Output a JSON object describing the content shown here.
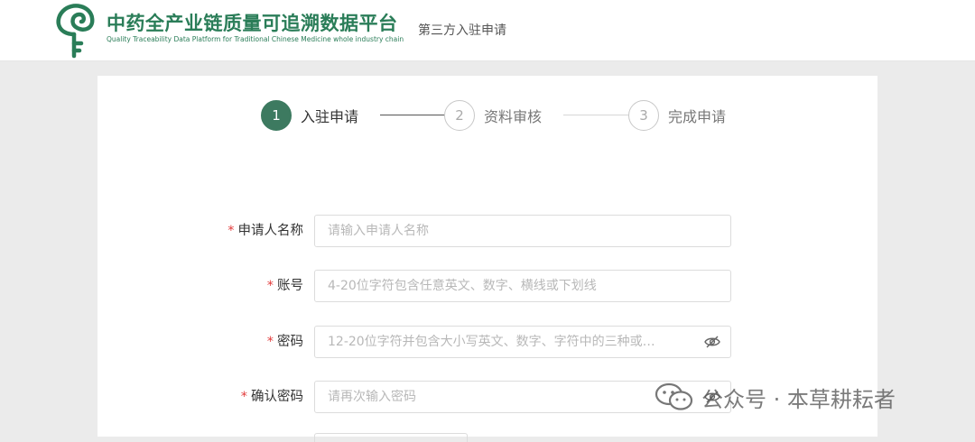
{
  "header": {
    "brand_title": "中药全产业链质量可追溯数据平台",
    "brand_subtitle": "Quality Traceability Data Platform for Traditional Chinese Medicine whole industry chain",
    "tag": "第三方入驻申请"
  },
  "steps": [
    {
      "number": "1",
      "label": "入驻申请",
      "state": "active"
    },
    {
      "number": "2",
      "label": "资料审核",
      "state": "pending"
    },
    {
      "number": "3",
      "label": "完成申请",
      "state": "pending"
    }
  ],
  "form": {
    "required_mark": "*",
    "fields": [
      {
        "label": "申请人名称",
        "value": "",
        "placeholder": "请输入申请人名称"
      },
      {
        "label": "账号",
        "value": "",
        "placeholder": "4-20位字符包含任意英文、数字、横线或下划线"
      },
      {
        "label": "密码",
        "value": "",
        "placeholder": "12-20位字符并包含大小写英文、数字、字符中的三种或…",
        "icon": "eye-slash-icon"
      },
      {
        "label": "确认密码",
        "value": "",
        "placeholder": "请再次输入密码",
        "icon": "eye-slash-icon"
      }
    ]
  },
  "watermark": {
    "text": "公众号 · 本草耕耘者",
    "icon": "wechat-icon"
  },
  "colors": {
    "brand_green": "#2a7d58",
    "step_active": "#3d7a60",
    "required_red": "#e23b3b",
    "page_bg": "#ebebeb"
  }
}
